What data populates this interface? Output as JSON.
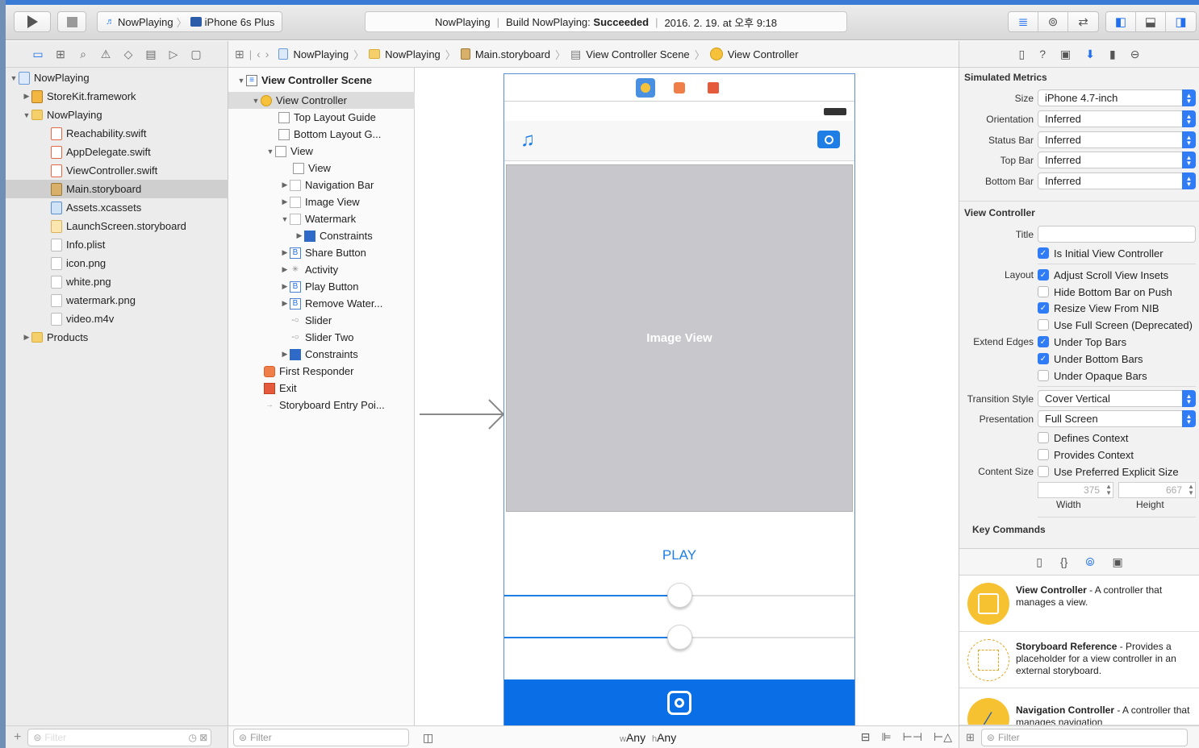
{
  "toolbar": {
    "scheme_target": "NowPlaying",
    "scheme_device": "iPhone 6s Plus",
    "activity_project": "NowPlaying",
    "activity_build_prefix": "Build NowPlaying:",
    "activity_build_status": "Succeeded",
    "activity_time": "2016. 2. 19. at 오후 9:18"
  },
  "navigator": {
    "items": [
      {
        "label": "NowPlaying",
        "icon": "project-icon"
      },
      {
        "label": "StoreKit.framework",
        "icon": "toolbox-icon"
      },
      {
        "label": "NowPlaying",
        "icon": "folder-icon"
      },
      {
        "label": "Reachability.swift",
        "icon": "swift-file-icon"
      },
      {
        "label": "AppDelegate.swift",
        "icon": "swift-file-icon"
      },
      {
        "label": "ViewController.swift",
        "icon": "swift-file-icon"
      },
      {
        "label": "Main.storyboard",
        "icon": "storyboard-icon"
      },
      {
        "label": "Assets.xcassets",
        "icon": "assets-icon"
      },
      {
        "label": "LaunchScreen.storyboard",
        "icon": "storyboard-icon"
      },
      {
        "label": "Info.plist",
        "icon": "plist-icon"
      },
      {
        "label": "icon.png",
        "icon": "image-file-icon"
      },
      {
        "label": "white.png",
        "icon": "image-file-icon"
      },
      {
        "label": "watermark.png",
        "icon": "image-file-icon"
      },
      {
        "label": "video.m4v",
        "icon": "video-file-icon"
      },
      {
        "label": "Products",
        "icon": "folder-icon"
      }
    ],
    "filter_placeholder": "Filter"
  },
  "jumpbar": {
    "crumbs": [
      "NowPlaying",
      "NowPlaying",
      "Main.storyboard",
      "View Controller Scene",
      "View Controller"
    ]
  },
  "outline": {
    "items": [
      "View Controller Scene",
      "View Controller",
      "Top Layout Guide",
      "Bottom Layout G...",
      "View",
      "View",
      "Navigation Bar",
      "Image View",
      "Watermark",
      "Constraints",
      "Share Button",
      "Activity",
      "Play Button",
      "Remove Water...",
      "Slider",
      "Slider Two",
      "Constraints",
      "First Responder",
      "Exit",
      "Storyboard Entry Poi..."
    ],
    "filter_placeholder": "Filter"
  },
  "canvas": {
    "image_view_label": "Image View",
    "play_label": "PLAY",
    "slider_one_value": 0.5,
    "slider_two_value": 0.5,
    "size_class_w": "Any",
    "size_class_h": "Any",
    "w_prefix": "w",
    "h_prefix": "h"
  },
  "inspector": {
    "simulated_metrics_title": "Simulated Metrics",
    "size_label": "Size",
    "size_value": "iPhone 4.7-inch",
    "orientation_label": "Orientation",
    "orientation_value": "Inferred",
    "status_bar_label": "Status Bar",
    "status_bar_value": "Inferred",
    "top_bar_label": "Top Bar",
    "top_bar_value": "Inferred",
    "bottom_bar_label": "Bottom Bar",
    "bottom_bar_value": "Inferred",
    "view_controller_title": "View Controller",
    "title_label": "Title",
    "title_value": "",
    "is_initial": "Is Initial View Controller",
    "layout_label": "Layout",
    "adjust_scroll": "Adjust Scroll View Insets",
    "hide_bottom_bar": "Hide Bottom Bar on Push",
    "resize_view": "Resize View From NIB",
    "use_full_screen": "Use Full Screen (Deprecated)",
    "extend_edges_label": "Extend Edges",
    "under_top_bars": "Under Top Bars",
    "under_bottom_bars": "Under Bottom Bars",
    "under_opaque_bars": "Under Opaque Bars",
    "transition_style_label": "Transition Style",
    "transition_style_value": "Cover Vertical",
    "presentation_label": "Presentation",
    "presentation_value": "Full Screen",
    "defines_context": "Defines Context",
    "provides_context": "Provides Context",
    "content_size_label": "Content Size",
    "use_preferred_size": "Use Preferred Explicit Size",
    "width_value": "375",
    "height_value": "667",
    "width_label": "Width",
    "height_label": "Height",
    "key_commands_title": "Key Commands",
    "checkboxes": {
      "is_initial": true,
      "adjust_scroll": true,
      "hide_bottom_bar": false,
      "resize_view": true,
      "use_full_screen": false,
      "under_top_bars": true,
      "under_bottom_bars": true,
      "under_opaque_bars": false,
      "defines_context": false,
      "provides_context": false,
      "use_preferred_size": false
    }
  },
  "library": {
    "items": [
      {
        "name": "View Controller",
        "desc": " - A controller that manages a view."
      },
      {
        "name": "Storyboard Reference",
        "desc": " - Provides a placeholder for a view controller in an external storyboard."
      },
      {
        "name": "Navigation Controller",
        "desc": " - A controller that manages navigation"
      }
    ],
    "filter_placeholder": "Filter"
  },
  "colors": {
    "accent": "#2f7cf6",
    "share_bar": "#0a6ee6",
    "play_text": "#1f7de6"
  }
}
